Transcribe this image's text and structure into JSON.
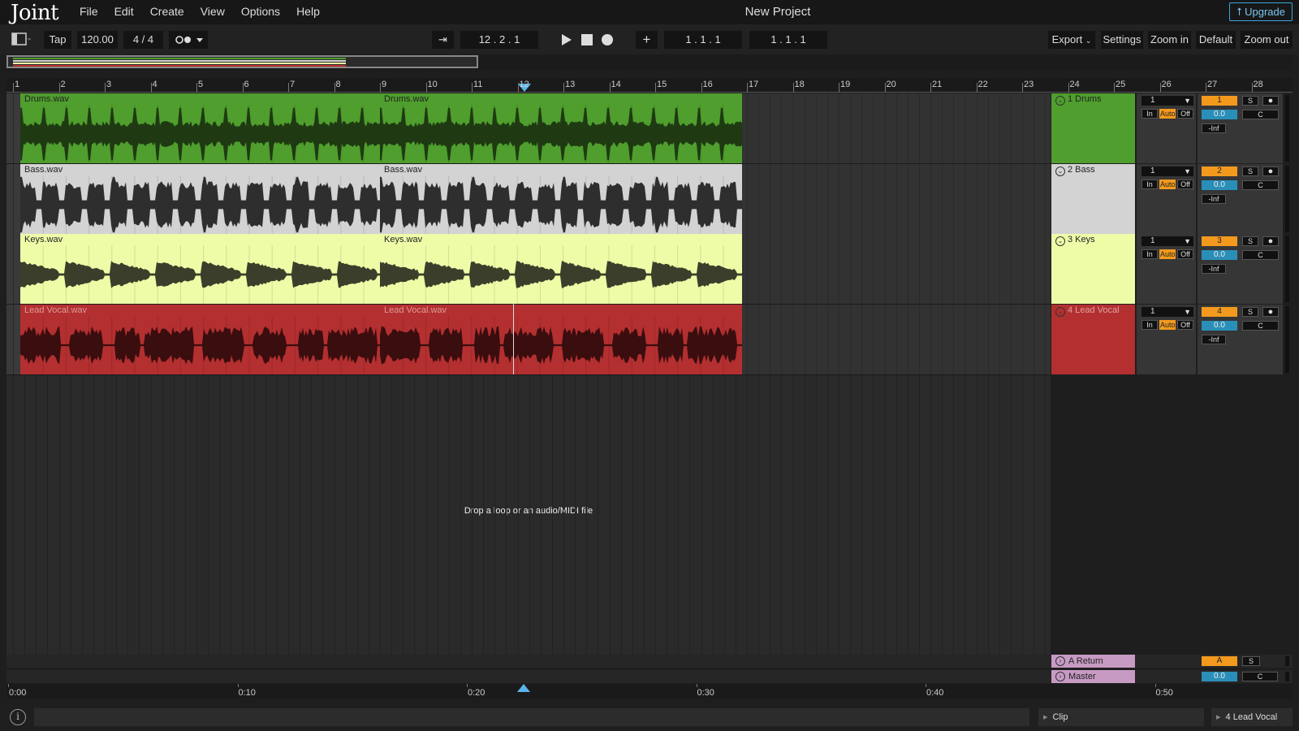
{
  "app": {
    "logo": "Joint",
    "project_title": "New Project",
    "upgrade_label": "Upgrade"
  },
  "menu": [
    "File",
    "Edit",
    "Create",
    "View",
    "Options",
    "Help"
  ],
  "toolbar": {
    "tap_label": "Tap",
    "tempo": "120.00",
    "time_sig": "4 / 4",
    "position": "12 .  2 .  1",
    "loop_start": "1 .  1 .  1",
    "loop_length": "1 .  1 .  1",
    "export_label": "Export",
    "settings_label": "Settings",
    "zoom_in_label": "Zoom in",
    "default_label": "Default",
    "zoom_out_label": "Zoom out"
  },
  "ruler": {
    "bars": [
      1,
      2,
      3,
      4,
      5,
      6,
      7,
      8,
      9,
      10,
      11,
      12,
      13,
      14,
      15,
      16,
      17,
      18,
      19,
      20,
      21,
      22,
      23,
      24,
      25,
      26,
      27,
      28
    ]
  },
  "tracks": [
    {
      "number": "1",
      "name": "1 Drums",
      "clip": "Drums.wav",
      "color": "#4f9e2e",
      "wave_color": "#1f3a12",
      "name_color": "#222",
      "input": "1",
      "in": "In",
      "auto": "Auto",
      "off": "Off",
      "volume": "0.0",
      "pan": "C",
      "send": "-Inf",
      "solo": "S"
    },
    {
      "number": "2",
      "name": "2 Bass",
      "clip": "Bass.wav",
      "color": "#d3d3d3",
      "wave_color": "#2e2e2e",
      "name_color": "#222",
      "input": "1",
      "in": "In",
      "auto": "Auto",
      "off": "Off",
      "volume": "0.0",
      "pan": "C",
      "send": "-Inf",
      "solo": "S"
    },
    {
      "number": "3",
      "name": "3 Keys",
      "clip": "Keys.wav",
      "color": "#eefca8",
      "wave_color": "#3b3e2a",
      "name_color": "#222",
      "input": "1",
      "in": "In",
      "auto": "Auto",
      "off": "Off",
      "volume": "0.0",
      "pan": "C",
      "send": "-Inf",
      "solo": "S"
    },
    {
      "number": "4",
      "name": "4 Lead Vocal",
      "clip": "Lead Vocal.wav",
      "color": "#b32f30",
      "wave_color": "#3a0d0e",
      "name_color": "#d99",
      "input": "1",
      "in": "In",
      "auto": "Auto",
      "off": "Off",
      "volume": "0.0",
      "pan": "C",
      "send": "-Inf",
      "solo": "S"
    }
  ],
  "drop_hint": "Drop a loop or an audio/MIDI file",
  "returns": {
    "name": "A Return",
    "label": "A",
    "solo": "S"
  },
  "master": {
    "name": "Master",
    "volume": "0.0",
    "pan": "C"
  },
  "time_ruler": [
    "0:00",
    "0:10",
    "0:20",
    "0:30",
    "0:40",
    "0:50"
  ],
  "status": {
    "clip_label": "Clip",
    "selected_track": "4 Lead Vocal"
  }
}
